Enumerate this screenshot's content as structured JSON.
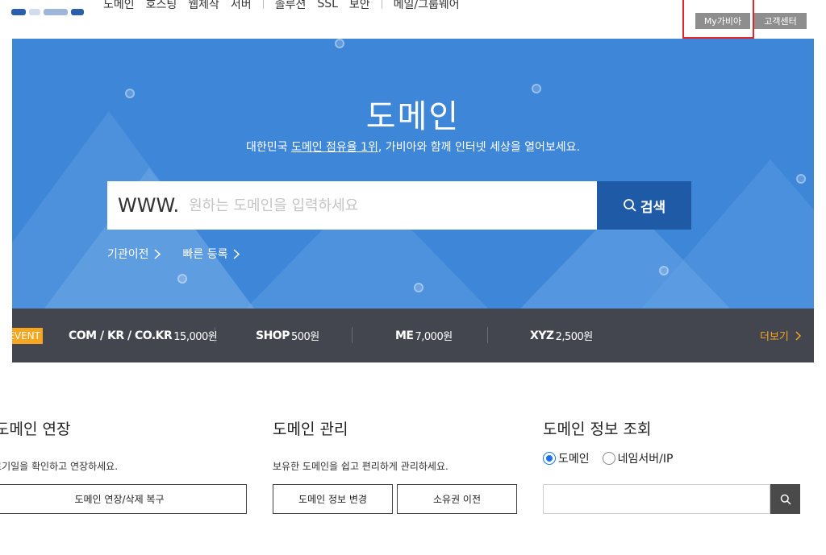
{
  "header": {
    "nav": [
      "도메인",
      "호스팅",
      "웹제작",
      "서버",
      "솔루션",
      "SSL",
      "보안",
      "메일/그룹웨어"
    ],
    "my_gabia": "My가비아",
    "customer_center": "고객센터"
  },
  "hero": {
    "title": "도메인",
    "subtitle_prefix": "대한민국 ",
    "subtitle_link": "도메인 점유율 1위",
    "subtitle_suffix": ", 가비아와 함께 인터넷 세상을 열어보세요.",
    "search_prefix": "WWW.",
    "search_placeholder": "원하는 도메인을 입력하세요",
    "search_button": "검색",
    "link_transfer": "기관이전",
    "link_quick": "빠른 등록"
  },
  "price_strip": {
    "event": "EVENT",
    "items": [
      {
        "name": "COM / KR / CO.KR",
        "price": "15,000원"
      },
      {
        "name": "SHOP",
        "price": "500원"
      },
      {
        "name": "ME",
        "price": "7,000원"
      },
      {
        "name": "XYZ",
        "price": "2,500원"
      }
    ],
    "more": "더보기"
  },
  "panels": {
    "renew": {
      "title": "도메인 연장",
      "desc": "만료기일을 확인하고 연장하세요.",
      "button": "도메인 연장/삭제 복구"
    },
    "manage": {
      "title": "도메인 관리",
      "desc": "보유한 도메인을 쉽고 편리하게 관리하세요.",
      "button_info": "도메인 정보 변경",
      "button_owner": "소유권 이전"
    },
    "lookup": {
      "title": "도메인 정보 조회",
      "radio_domain": "도메인",
      "radio_ns": "네임서버/IP",
      "selected": "도메인",
      "input_value": ""
    }
  },
  "colors": {
    "hero_bg": "#3d86d8",
    "search_button": "#1f5aa6",
    "strip_bg": "#43464e",
    "accent": "#f7a61f",
    "highlight": "#e0252b"
  }
}
